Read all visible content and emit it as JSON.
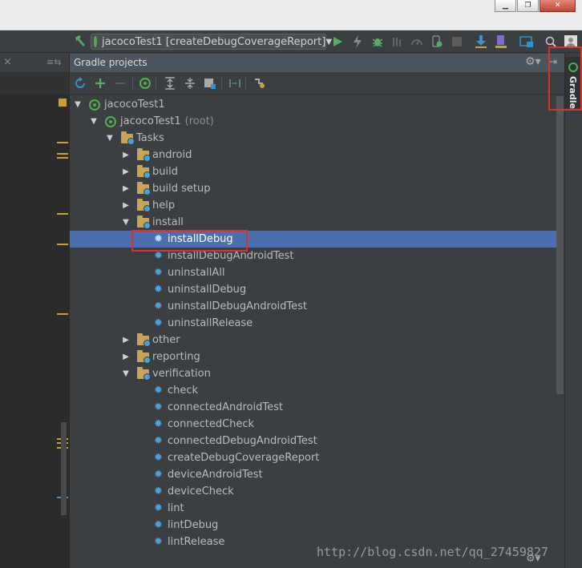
{
  "window": {
    "minimize": "▁",
    "maximize": "❐",
    "close": "✕"
  },
  "toolbar": {
    "run_config": "jacocoTest1 [createDebugCoverageReport]"
  },
  "left": {
    "close": "×",
    "menu": "≡⇆"
  },
  "panel": {
    "title": "Gradle projects"
  },
  "tree": {
    "root": "jacocoTest1",
    "module": "jacocoTest1",
    "module_suffix": "(root)",
    "tasks": "Tasks",
    "groups": [
      "android",
      "build",
      "build setup",
      "help"
    ],
    "install": "install",
    "install_tasks": [
      "installDebug",
      "installDebugAndroidTest",
      "uninstallAll",
      "uninstallDebug",
      "uninstallDebugAndroidTest",
      "uninstallRelease"
    ],
    "groups2": [
      "other",
      "reporting"
    ],
    "verification": "verification",
    "verification_tasks": [
      "check",
      "connectedAndroidTest",
      "connectedCheck",
      "connectedDebugAndroidTest",
      "createDebugCoverageReport",
      "deviceAndroidTest",
      "deviceCheck",
      "lint",
      "lintDebug",
      "lintRelease"
    ],
    "selected": "installDebug"
  },
  "right_strip": {
    "gradle_tab": "Gradle"
  },
  "watermark": "http://blog.csdn.net/qq_27459827",
  "colors": {
    "selection": "#4b6eaf",
    "highlight": "#e0302a",
    "gradle_green": "#4fae4c"
  }
}
